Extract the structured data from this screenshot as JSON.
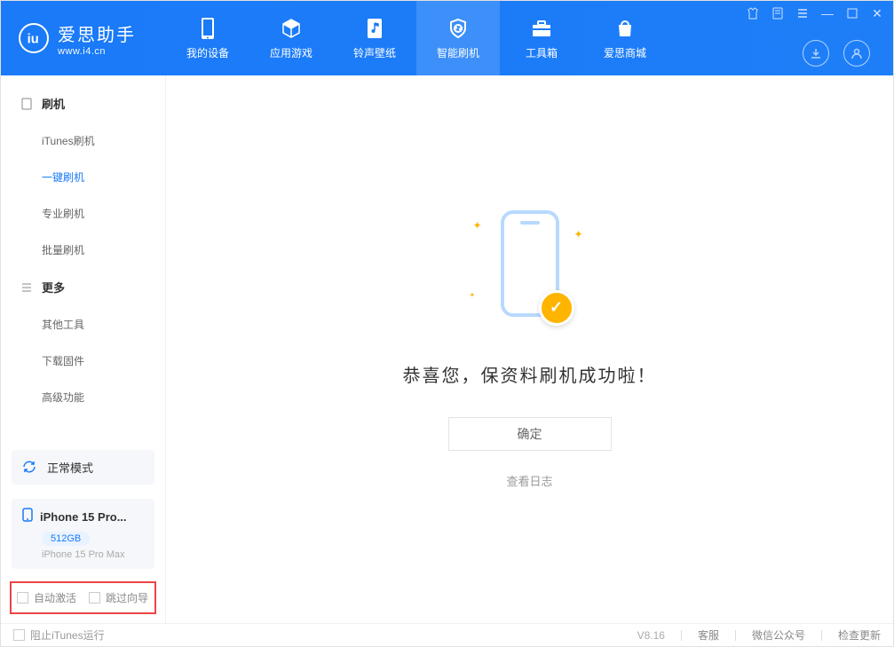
{
  "app": {
    "name_cn": "爱思助手",
    "name_en": "www.i4.cn"
  },
  "nav": [
    {
      "label": "我的设备"
    },
    {
      "label": "应用游戏"
    },
    {
      "label": "铃声壁纸"
    },
    {
      "label": "智能刷机",
      "active": true
    },
    {
      "label": "工具箱"
    },
    {
      "label": "爱思商城"
    }
  ],
  "sidebar": {
    "group1": {
      "title": "刷机",
      "items": [
        "iTunes刷机",
        "一键刷机",
        "专业刷机",
        "批量刷机"
      ],
      "active_index": 1
    },
    "group2": {
      "title": "更多",
      "items": [
        "其他工具",
        "下载固件",
        "高级功能"
      ]
    }
  },
  "mode": {
    "label": "正常模式"
  },
  "device": {
    "name": "iPhone 15 Pro...",
    "storage": "512GB",
    "model": "iPhone 15 Pro Max"
  },
  "options": {
    "auto_activate": "自动激活",
    "skip_wizard": "跳过向导"
  },
  "main": {
    "success_title": "恭喜您，保资料刷机成功啦！",
    "ok_button": "确定",
    "view_log": "查看日志"
  },
  "footer": {
    "block_itunes": "阻止iTunes运行",
    "version": "V8.16",
    "support": "客服",
    "wechat": "微信公众号",
    "check_update": "检查更新"
  }
}
